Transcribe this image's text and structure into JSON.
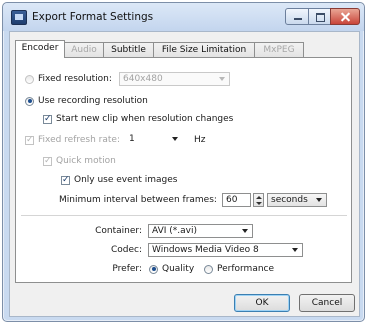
{
  "window": {
    "title": "Export Format Settings"
  },
  "tabs": [
    {
      "label": "Encoder",
      "active": true,
      "enabled": true
    },
    {
      "label": "Audio",
      "active": false,
      "enabled": false
    },
    {
      "label": "Subtitle",
      "active": false,
      "enabled": true
    },
    {
      "label": "File Size Limitation",
      "active": false,
      "enabled": true
    },
    {
      "label": "MxPEG",
      "active": false,
      "enabled": false
    }
  ],
  "encoder": {
    "fixed_resolution": {
      "label": "Fixed resolution:",
      "checked": false,
      "value": "640x480"
    },
    "use_recording_resolution": {
      "label": "Use recording resolution",
      "checked": true
    },
    "start_new_clip": {
      "label": "Start new clip when resolution changes",
      "checked": true
    },
    "fixed_refresh_rate": {
      "label": "Fixed refresh rate:",
      "checked": true,
      "value": "1",
      "unit": "Hz"
    },
    "quick_motion": {
      "label": "Quick motion",
      "checked": true
    },
    "only_event_images": {
      "label": "Only use event images",
      "checked": true
    },
    "min_interval": {
      "label": "Minimum interval between frames:",
      "value": "60",
      "unit": "seconds"
    },
    "container": {
      "label": "Container:",
      "value": "AVI (*.avi)"
    },
    "codec": {
      "label": "Codec:",
      "value": "Windows Media Video 8"
    },
    "prefer": {
      "label": "Prefer:",
      "options": [
        "Quality",
        "Performance"
      ],
      "selected": "Quality"
    }
  },
  "buttons": {
    "ok": "OK",
    "cancel": "Cancel"
  }
}
